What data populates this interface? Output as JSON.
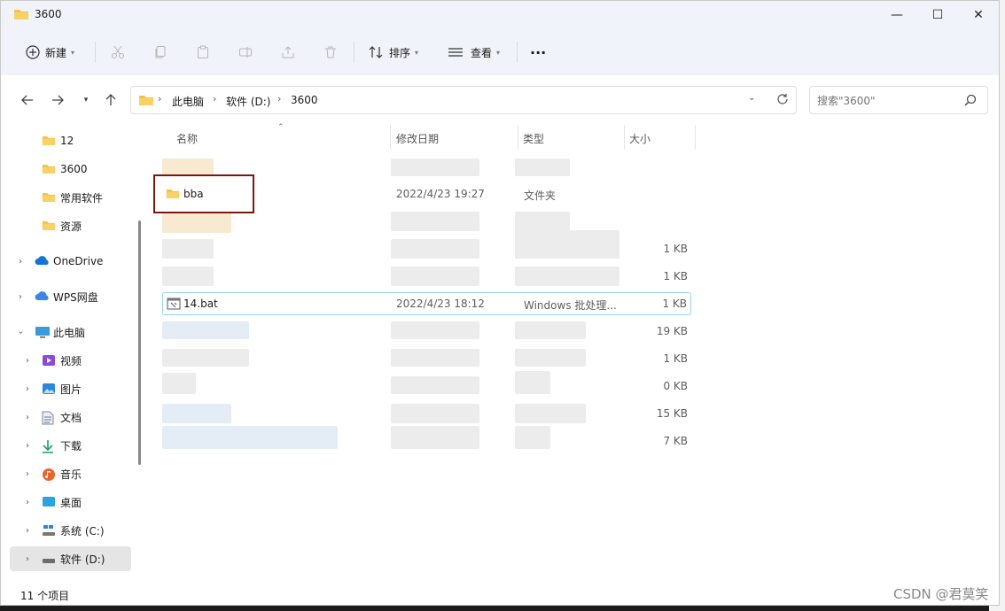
{
  "window": {
    "title": "3600"
  },
  "titlebar": {
    "minimize": "—",
    "maximize": "☐",
    "close": "✕"
  },
  "toolbar": {
    "new_label": "新建",
    "sort_label": "排序",
    "view_label": "查看",
    "more_label": "···"
  },
  "address": {
    "crumbs": [
      "此电脑",
      "软件 (D:)",
      "3600"
    ],
    "search_placeholder": "搜索\"3600\""
  },
  "sidebar": {
    "items": [
      {
        "label": "12"
      },
      {
        "label": "3600"
      },
      {
        "label": "常用软件"
      },
      {
        "label": "资源"
      },
      {
        "label": "OneDrive"
      },
      {
        "label": "WPS网盘"
      },
      {
        "label": "此电脑"
      },
      {
        "label": "视频"
      },
      {
        "label": "图片"
      },
      {
        "label": "文档"
      },
      {
        "label": "下载"
      },
      {
        "label": "音乐"
      },
      {
        "label": "桌面"
      },
      {
        "label": "系统 (C:)"
      },
      {
        "label": "软件 (D:)"
      }
    ]
  },
  "columns": {
    "name": "名称",
    "modified": "修改日期",
    "type": "类型",
    "size": "大小"
  },
  "files": [
    {
      "name": "",
      "modified": "",
      "type": "",
      "size": ""
    },
    {
      "name": "bba",
      "modified": "2022/4/23 19:27",
      "type": "文件夹",
      "size": ""
    },
    {
      "name": "",
      "modified": "",
      "type": "",
      "size": ""
    },
    {
      "name": "",
      "modified": "",
      "type": "",
      "size": "1 KB"
    },
    {
      "name": "",
      "modified": "",
      "type": "",
      "size": "1 KB"
    },
    {
      "name": "14.bat",
      "modified": "2022/4/23 18:12",
      "type": "Windows 批处理...",
      "size": "1 KB"
    },
    {
      "name": "",
      "modified": "",
      "type": "",
      "size": "19 KB"
    },
    {
      "name": "",
      "modified": "",
      "type": "",
      "size": "1 KB"
    },
    {
      "name": "",
      "modified": "",
      "type": "",
      "size": "0 KB"
    },
    {
      "name": "",
      "modified": "",
      "type": "",
      "size": "15 KB"
    },
    {
      "name": "",
      "modified": "",
      "type": "",
      "size": "7 KB"
    }
  ],
  "status": {
    "count": "11 个项目"
  },
  "watermark": "CSDN @君莫笑",
  "colors": {
    "accent": "#0067c0",
    "selection_border": "#99d4e8",
    "annotation": "#7a1712",
    "folder": "#f4c247"
  }
}
